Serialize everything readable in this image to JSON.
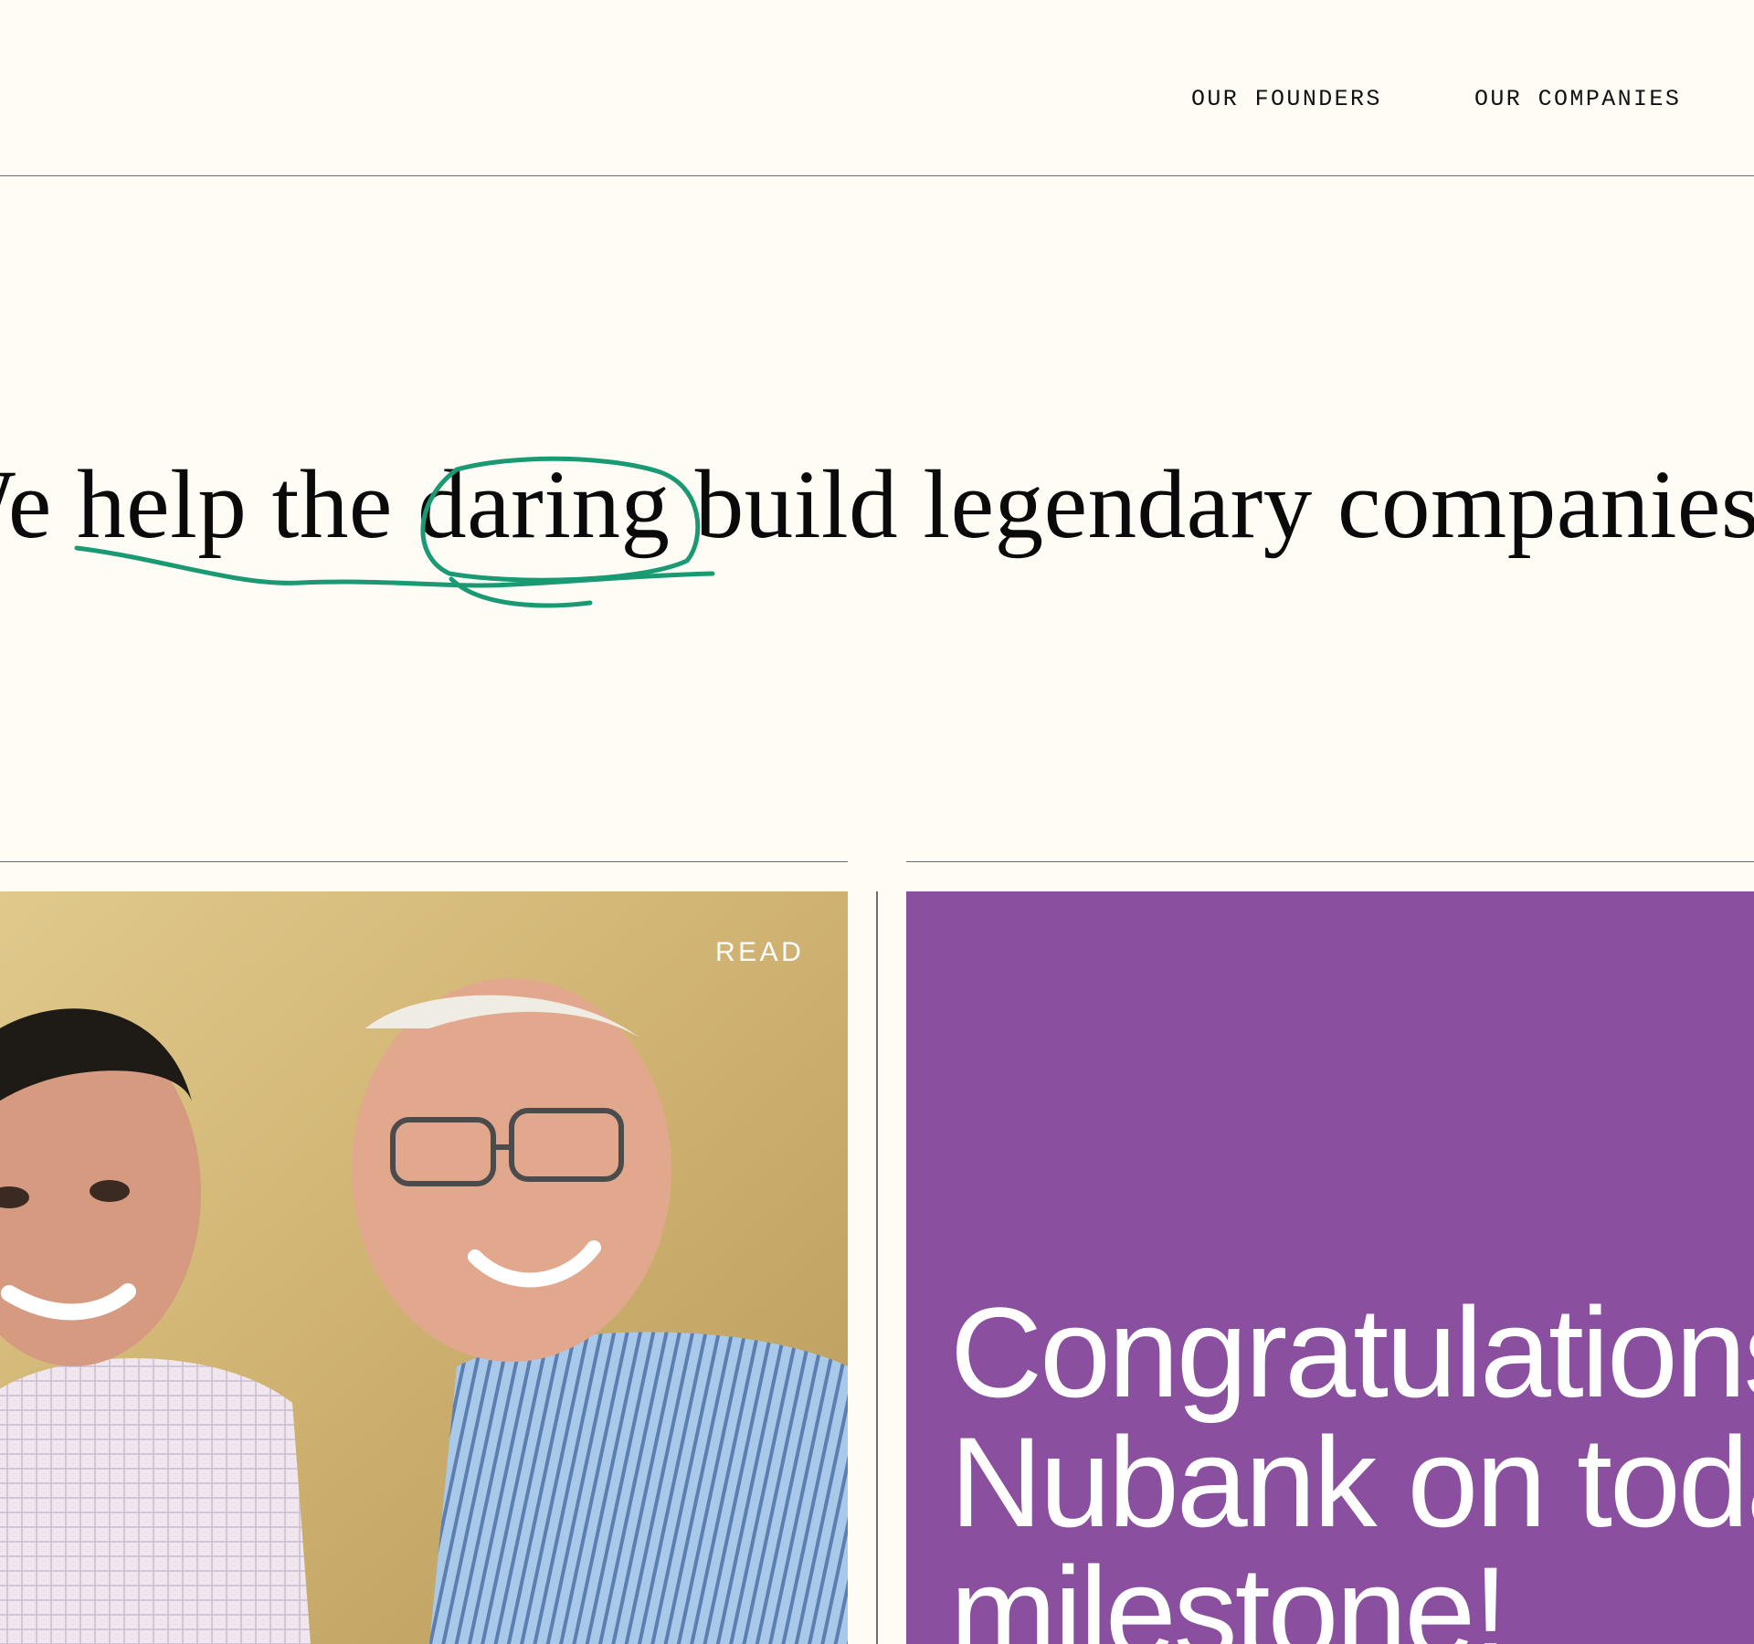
{
  "nav": {
    "founders_label": "OUR FOUNDERS",
    "companies_label": "OUR COMPANIES"
  },
  "hero": {
    "headline": "We help the daring build legendary companies",
    "highlight_color": "#1a9a72"
  },
  "feature": {
    "read_label": "READ",
    "photo_alt": "Two smiling founders posing together"
  },
  "promo": {
    "headline": "Congratulations Nubank on today's milestone!",
    "background_color": "#8a4f9e"
  }
}
